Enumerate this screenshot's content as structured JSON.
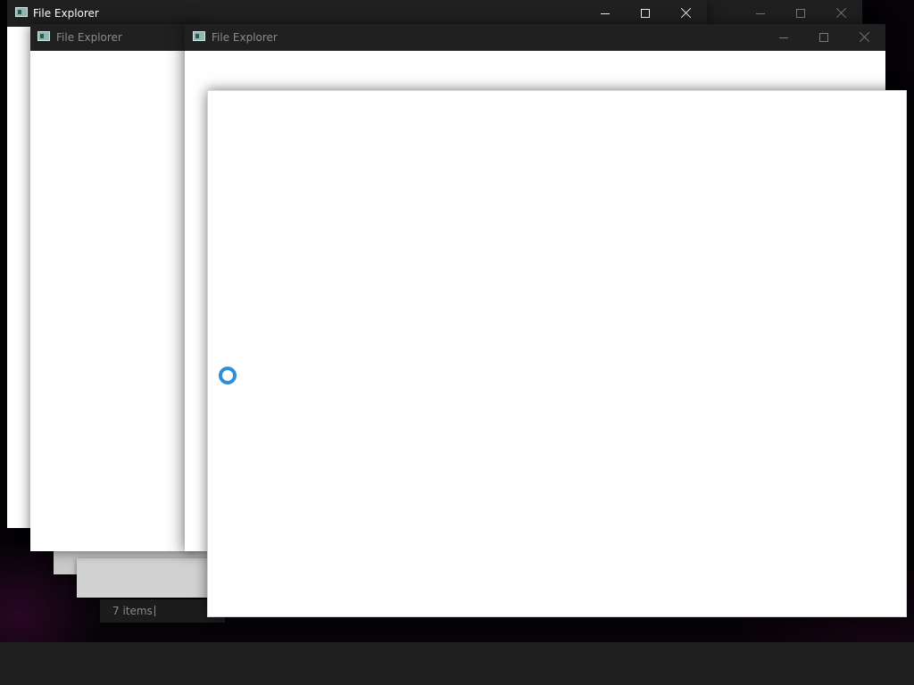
{
  "windows": {
    "back_right": {
      "title": ""
    },
    "back": {
      "title": "File Explorer"
    },
    "middle": {
      "title": "File Explorer"
    },
    "front_right": {
      "title": "File Explorer"
    },
    "loading": {
      "title": ""
    }
  },
  "status": {
    "items_count": "7 items"
  },
  "icons": {
    "app": "file-explorer-icon",
    "minimize": "minimize-icon",
    "maximize": "maximize-icon",
    "close": "close-icon",
    "loading": "loading-spinner-icon"
  },
  "colors": {
    "titlebar": "#202020",
    "title_active": "#ffffff",
    "title_inactive": "#8a8a8a",
    "window_bg": "#ffffff",
    "spinner": "#2e8fd8",
    "taskbar": "#1e1e1e"
  }
}
